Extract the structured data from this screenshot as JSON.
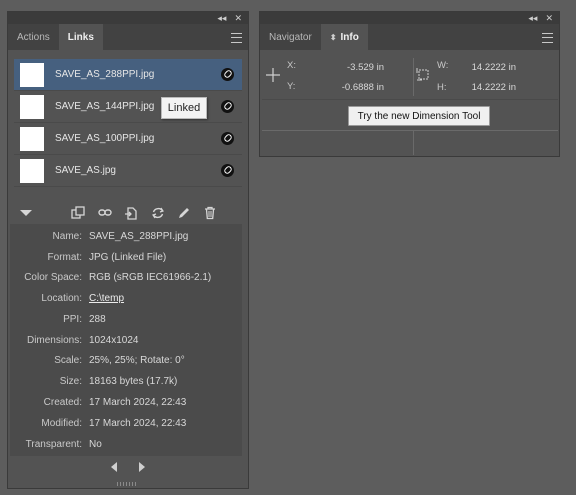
{
  "links_panel": {
    "tabs": [
      {
        "label": "Actions",
        "active": false
      },
      {
        "label": "Links",
        "active": true
      }
    ],
    "rows": [
      {
        "name": "SAVE_AS_288PPI.jpg",
        "selected": true
      },
      {
        "name": "SAVE_AS_144PPI.jpg",
        "selected": false
      },
      {
        "name": "SAVE_AS_100PPI.jpg",
        "selected": false
      },
      {
        "name": "SAVE_AS.jpg",
        "selected": false
      }
    ],
    "tooltip": "Linked",
    "toolbar_icons": [
      "expand-triangle-icon",
      "relink-icon",
      "go-to-link-icon",
      "edit-original-icon",
      "update-link-icon",
      "pencil-icon",
      "trash-icon"
    ],
    "info": [
      {
        "label": "Name:",
        "value": "SAVE_AS_288PPI.jpg"
      },
      {
        "label": "Format:",
        "value": "JPG (Linked File)"
      },
      {
        "label": "Color Space:",
        "value": "RGB (sRGB IEC61966-2.1)"
      },
      {
        "label": "Location:",
        "value": "C:\\temp",
        "link": true
      },
      {
        "label": "PPI:",
        "value": "288"
      },
      {
        "label": "Dimensions:",
        "value": "1024x1024"
      },
      {
        "label": "Scale:",
        "value": "25%, 25%; Rotate: 0°"
      },
      {
        "label": "Size:",
        "value": "18163 bytes (17.7k)"
      },
      {
        "label": "Created:",
        "value": "17 March 2024, 22:43"
      },
      {
        "label": "Modified:",
        "value": "17 March 2024, 22:43"
      },
      {
        "label": "Transparent:",
        "value": "No"
      }
    ]
  },
  "info_panel": {
    "tabs": [
      {
        "label": "Navigator",
        "active": false
      },
      {
        "label": "Info",
        "active": true
      }
    ],
    "x_label": "X:",
    "x_value": "-3.529 in",
    "y_label": "Y:",
    "y_value": "-0.6888 in",
    "w_label": "W:",
    "w_value": "14.2222 in",
    "h_label": "H:",
    "h_value": "14.2222 in",
    "button": "Try the new Dimension Tool"
  },
  "window_controls": {
    "collapse": "◂◂",
    "close": "✕"
  }
}
